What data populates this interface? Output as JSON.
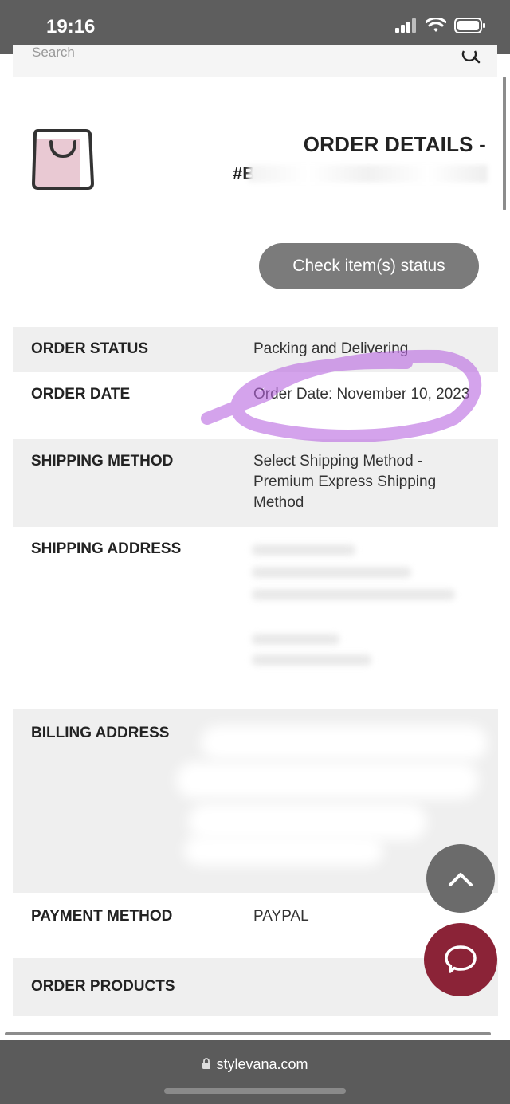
{
  "status_bar": {
    "time": "19:16"
  },
  "search": {
    "placeholder": "Search"
  },
  "header": {
    "title": "ORDER DETAILS -",
    "order_number_prefix": "#B"
  },
  "check_status_button": "Check item(s) status",
  "rows": [
    {
      "label": "ORDER STATUS",
      "value": "Packing and Delivering"
    },
    {
      "label": "ORDER DATE",
      "value": "Order Date: November 10, 2023"
    },
    {
      "label": "SHIPPING METHOD",
      "value": "Select Shipping Method - Premium Express Shipping Method"
    },
    {
      "label": "SHIPPING ADDRESS",
      "value": ""
    },
    {
      "label": "BILLING ADDRESS",
      "value": ""
    },
    {
      "label": "PAYMENT METHOD",
      "value": "PAYPAL"
    },
    {
      "label": "ORDER PRODUCTS",
      "value": ""
    }
  ],
  "browser": {
    "url": "stylevana.com"
  },
  "colors": {
    "accent_purple": "#b865e0",
    "chat_button": "#8b2337",
    "button_gray": "#7b7b7b"
  },
  "icons": {
    "bag": "shopping-bag-icon",
    "scroll_top": "chevron-up-icon",
    "chat": "chat-bubble-icon",
    "lock": "lock-icon"
  }
}
